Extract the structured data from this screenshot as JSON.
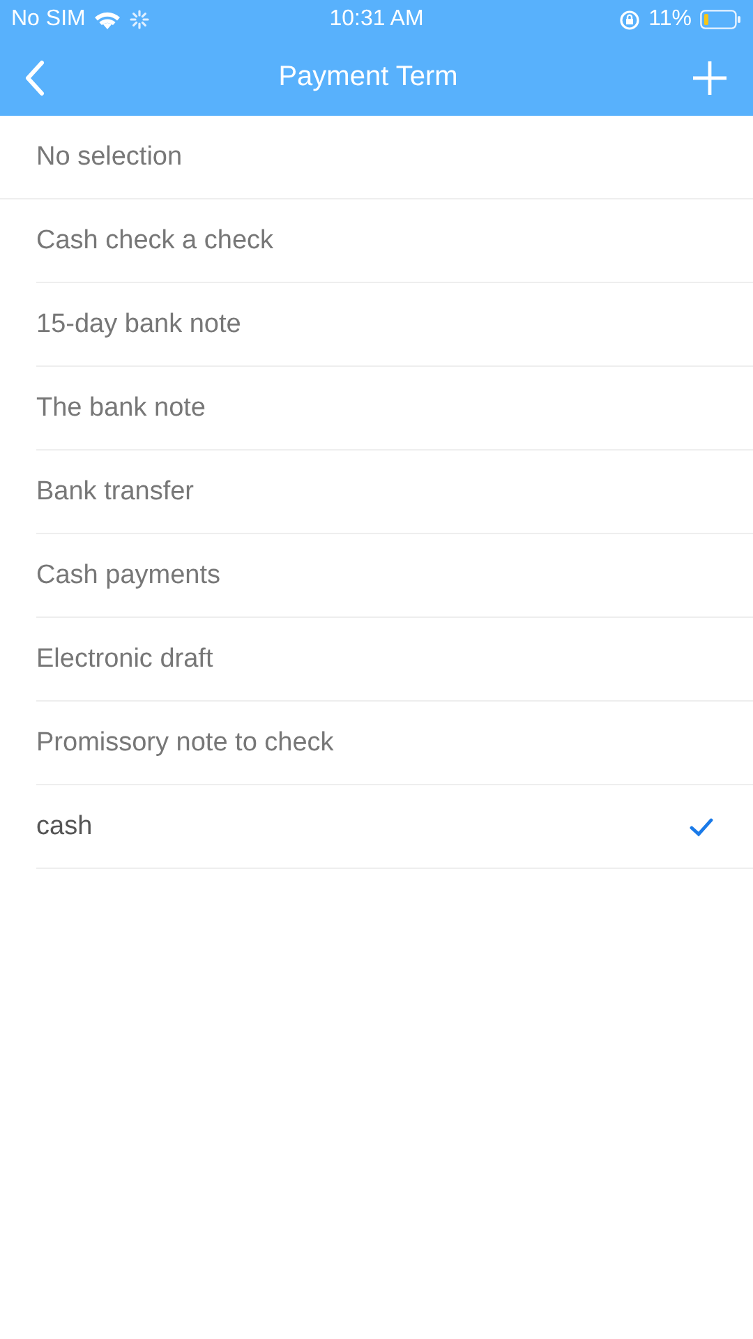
{
  "status_bar": {
    "carrier": "No SIM",
    "time": "10:31 AM",
    "battery": "11%"
  },
  "nav_bar": {
    "title": "Payment Term"
  },
  "options": [
    {
      "label": "No selection",
      "selected": false
    },
    {
      "label": "Cash check a check",
      "selected": false
    },
    {
      "label": "15-day bank note",
      "selected": false
    },
    {
      "label": "The bank note",
      "selected": false
    },
    {
      "label": "Bank transfer",
      "selected": false
    },
    {
      "label": "Cash payments",
      "selected": false
    },
    {
      "label": "Electronic draft",
      "selected": false
    },
    {
      "label": "Promissory note to check",
      "selected": false
    },
    {
      "label": "cash",
      "selected": true
    }
  ]
}
